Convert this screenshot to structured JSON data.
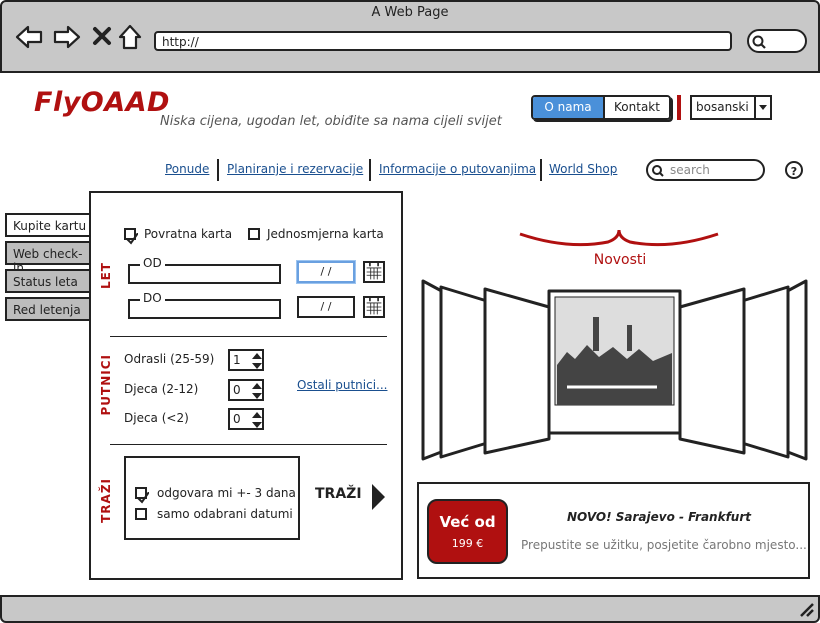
{
  "browser": {
    "title": "A Web Page",
    "url": "http://"
  },
  "header": {
    "logo": "FlyOAAD",
    "tagline": "Niska cijena, ugodan let, obiđite sa nama cijeli svijet",
    "btn_onama": "O nama",
    "btn_kontakt": "Kontakt",
    "language": "bosanski",
    "accent_color": "#b01010",
    "active_button_color": "#4a90d9"
  },
  "nav": {
    "links": [
      "Ponude",
      "Planiranje i rezervacije",
      "Informacije o putovanjima",
      "World Shop"
    ],
    "search_placeholder": "search",
    "help": "?"
  },
  "tabs": [
    "Kupite kartu",
    "Web check-in",
    "Status leta",
    "Red letenja"
  ],
  "form": {
    "let_label": "LET",
    "return_label": "Povratna karta",
    "return_checked": true,
    "oneway_label": "Jednosmjerna karta",
    "oneway_checked": false,
    "od_label": "OD",
    "do_label": "DO",
    "date_od": "/ /",
    "date_do": "/ /",
    "putnici_label": "PUTNICI",
    "adults_label": "Odrasli (25-59)",
    "adults_value": "1",
    "children_label": "Djeca (2-12)",
    "children_value": "0",
    "infants_label": "Djeca (<2)",
    "infants_value": "0",
    "other_passengers": "Ostali putnici...",
    "trazi_label": "TRAŽI",
    "opt1_label": "odgovara mi +- 3 dana",
    "opt1_checked": true,
    "opt2_label": "samo odabrani datumi",
    "opt2_checked": false,
    "search_button": "TRAŽI"
  },
  "news": {
    "title": "Novosti"
  },
  "promo": {
    "badge_title": "Već od",
    "badge_price": "199 €",
    "headline": "NOVO! Sarajevo - Frankfurt",
    "text": "Prepustite se užitku, posjetite čarobno mjesto..."
  }
}
